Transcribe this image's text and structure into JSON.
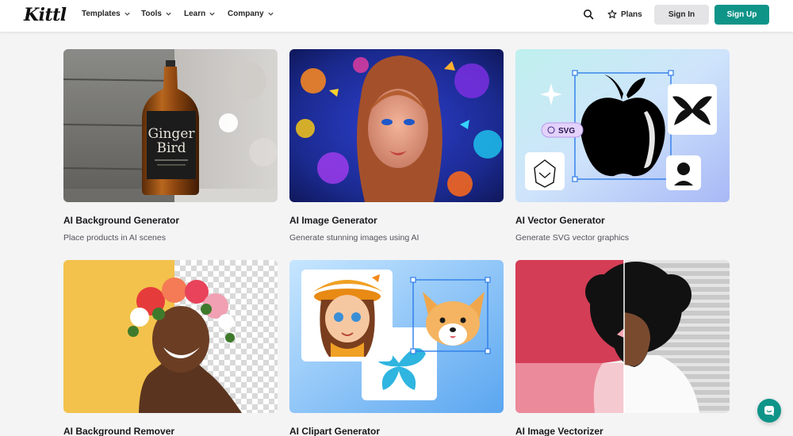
{
  "brand": {
    "logo_text": "Kittl",
    "accent": "#0f9488"
  },
  "nav": {
    "items": [
      {
        "label": "Templates"
      },
      {
        "label": "Tools"
      },
      {
        "label": "Learn"
      },
      {
        "label": "Company"
      }
    ],
    "plans_label": "Plans",
    "signin_label": "Sign In",
    "signup_label": "Sign Up"
  },
  "cards": [
    {
      "title": "AI Background Generator",
      "desc": "Place products in AI scenes",
      "label_top": "Ginger",
      "label_bottom": "Bird"
    },
    {
      "title": "AI Image Generator",
      "desc": "Generate stunning images using AI"
    },
    {
      "title": "AI Vector Generator",
      "desc": "Generate SVG vector graphics",
      "badge": "SVG"
    },
    {
      "title": "AI Background Remover",
      "desc": ""
    },
    {
      "title": "AI Clipart Generator",
      "desc": ""
    },
    {
      "title": "AI Image Vectorizer",
      "desc": ""
    }
  ]
}
